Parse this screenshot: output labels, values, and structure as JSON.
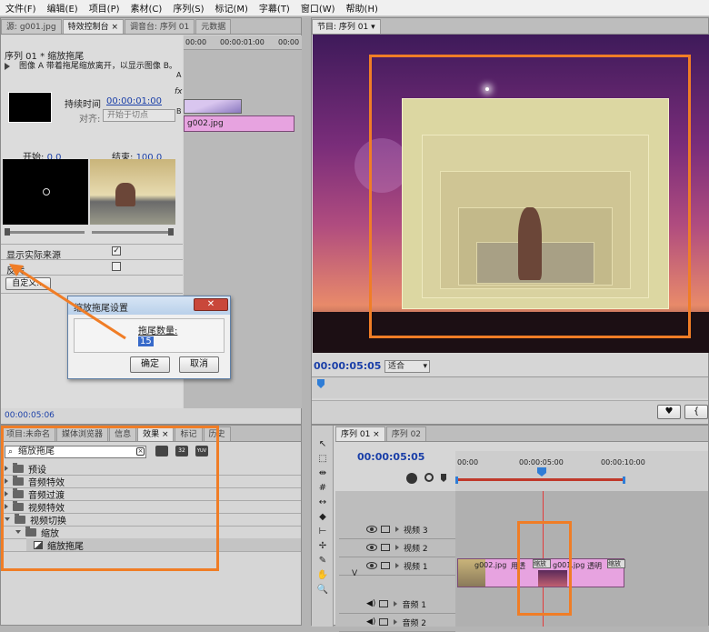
{
  "menu": [
    "文件(F)",
    "编辑(E)",
    "项目(P)",
    "素材(C)",
    "序列(S)",
    "标记(M)",
    "字幕(T)",
    "窗口(W)",
    "帮助(H)"
  ],
  "top_left_tabs": [
    "源: g001.jpg",
    "特效控制台 ×",
    "调音台: 序列 01",
    "元数据"
  ],
  "effect_controls": {
    "clip_title": "序列 01 * 缩放拖尾",
    "description": "图像 A 带着拖尾缩放离开，以显示图像 B。",
    "duration_label": "持续时间",
    "duration_value": "00:00:01:00",
    "align_label": "对齐:",
    "align_value": "开始于切点",
    "start_label": "开始:",
    "start_value": "0.0",
    "end_label": "结束:",
    "end_value": "100.0",
    "show_source_label": "显示实际来源",
    "reverse_label": "反转",
    "custom_button": "自定义...",
    "timecode": "00:00:05:06",
    "ruler_start": "00:00",
    "ruler_mark": "00:00:01:00",
    "ruler_end": "00:00",
    "letter_a": "A",
    "letter_b": "B",
    "clip_label": "g002.jpg"
  },
  "dialog": {
    "title": "缩放拖尾设置",
    "field_label": "拖尾数量:",
    "field_value": "15",
    "ok": "确定",
    "cancel": "取消"
  },
  "program": {
    "tab": "节目: 序列 01",
    "timecode": "00:00:05:05",
    "fit": "适合"
  },
  "effects_panel": {
    "tabs": [
      "项目:未命名",
      "媒体浏览器",
      "信息",
      "效果 ×",
      "标记",
      "历史"
    ],
    "search_value": "缩放拖尾",
    "items": [
      {
        "label": "预设",
        "level": 0,
        "open": false
      },
      {
        "label": "音频特效",
        "level": 0,
        "open": false
      },
      {
        "label": "音频过渡",
        "level": 0,
        "open": false
      },
      {
        "label": "视频特效",
        "level": 0,
        "open": false
      },
      {
        "label": "视频切换",
        "level": 0,
        "open": true
      },
      {
        "label": "缩放",
        "level": 1,
        "open": true
      },
      {
        "label": "缩放拖尾",
        "level": 2,
        "open": false
      }
    ]
  },
  "timeline": {
    "tabs": [
      "序列 01 ×",
      "序列 02"
    ],
    "timecode": "00:00:05:05",
    "ruler": [
      "00:00",
      "00:00:05:00",
      "00:00:10:00"
    ],
    "tracks": [
      "视频 3",
      "视频 2",
      "视频 1",
      "音频 1",
      "音频 2"
    ],
    "v_label": "V",
    "clips": [
      "g002.jpg",
      "用透",
      "缩放",
      "g001.jpg",
      "透明",
      "缩放"
    ]
  },
  "colors": {
    "accent": "#f07d26",
    "clip": "#e7a3e0",
    "playhead": "#2f7dd6",
    "timecode": "#1a3fa8"
  }
}
